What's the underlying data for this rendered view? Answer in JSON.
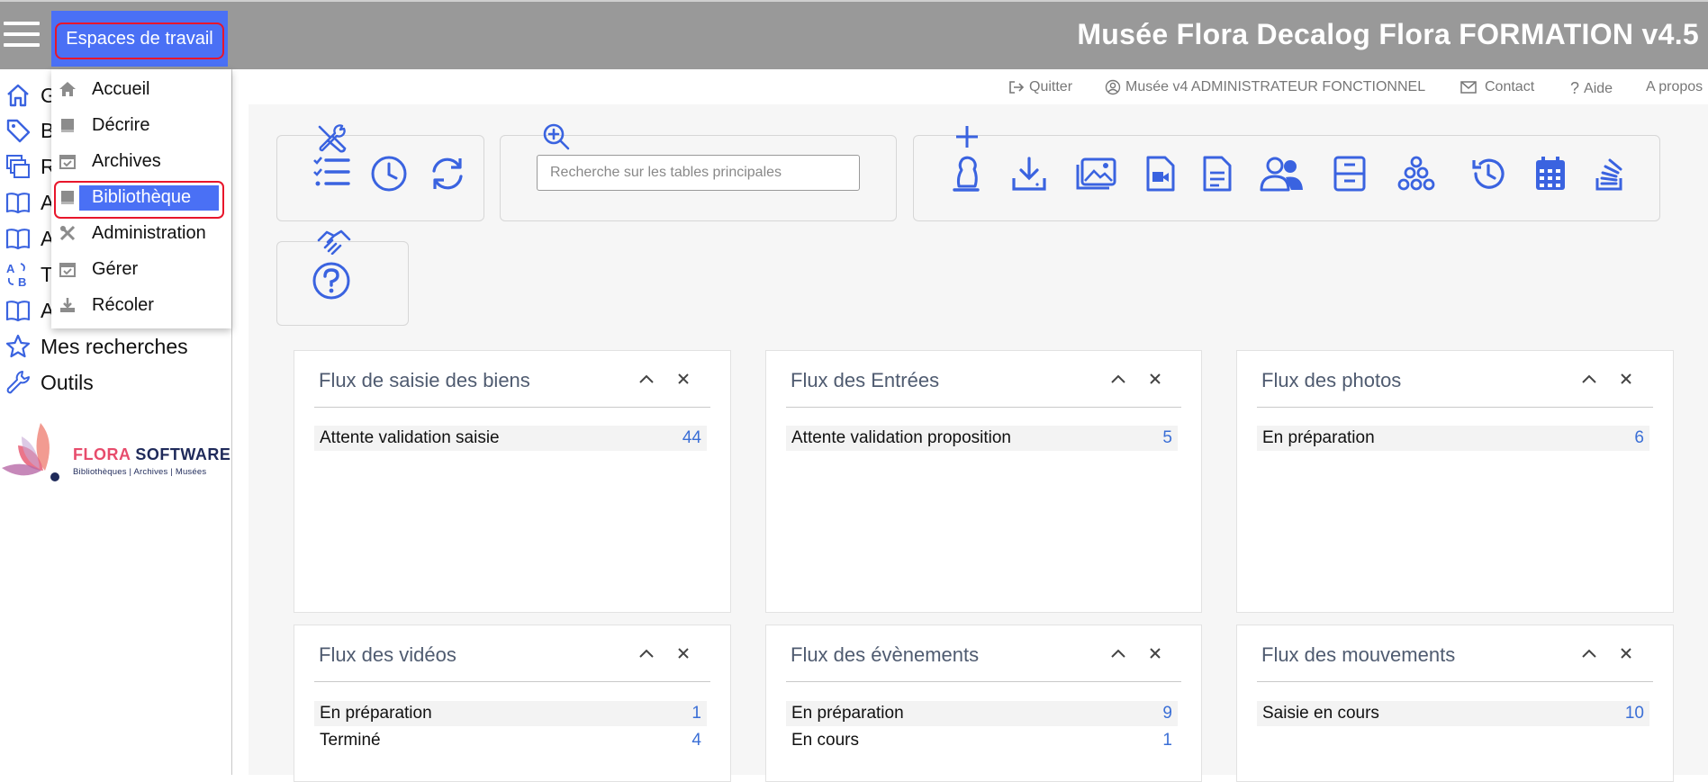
{
  "header": {
    "workspace_button": "Espaces de travail",
    "app_title": "Musée Flora Decalog Flora FORMATION v4.5"
  },
  "sidebar": {
    "items": [
      {
        "label": "G",
        "icon": "home-icon"
      },
      {
        "label": "B",
        "icon": "tag-icon"
      },
      {
        "label": "R",
        "icon": "stack-icon"
      },
      {
        "label": "A",
        "icon": "book-icon"
      },
      {
        "label": "A",
        "icon": "book-icon"
      },
      {
        "label": "T",
        "icon": "sort-az-icon"
      },
      {
        "label": "A",
        "icon": "book-icon"
      },
      {
        "label": "Mes recherches",
        "icon": "star-icon"
      },
      {
        "label": "Outils",
        "icon": "wrench-icon"
      }
    ],
    "logo": {
      "brand_a": "FLORA",
      "brand_b": "SOFTWARE",
      "tagline": "Bibliothèques | Archives | Musées"
    }
  },
  "dropdown": {
    "items": [
      {
        "label": "Accueil",
        "icon": "home-icon"
      },
      {
        "label": "Décrire",
        "icon": "book-icon"
      },
      {
        "label": "Archives",
        "icon": "calendar-check-icon"
      },
      {
        "label": "Bibliothèque",
        "icon": "book-icon"
      },
      {
        "label": "Administration",
        "icon": "tools-icon"
      },
      {
        "label": "Gérer",
        "icon": "calendar-check-icon"
      },
      {
        "label": "Récoler",
        "icon": "download-icon"
      }
    ],
    "active_index": 3
  },
  "toplinks": {
    "quit": "Quitter",
    "user": "Musée v4 ADMINISTRATEUR FONCTIONNEL",
    "contact": "Contact",
    "help": "Aide",
    "about": "A propos"
  },
  "search": {
    "placeholder": "Recherche sur les tables principales"
  },
  "colors": {
    "accent": "#4a70f5",
    "icon": "#3a63e0",
    "header": "#999999",
    "highlight_ring": "#e8162b"
  },
  "cards": [
    {
      "title": "Flux de saisie des biens",
      "rows": [
        {
          "label": "Attente validation saisie",
          "value": "44"
        }
      ]
    },
    {
      "title": "Flux des Entrées",
      "rows": [
        {
          "label": "Attente validation proposition",
          "value": "5"
        }
      ]
    },
    {
      "title": "Flux des photos",
      "rows": [
        {
          "label": "En préparation",
          "value": "6"
        }
      ]
    },
    {
      "title": "Flux des vidéos",
      "rows": [
        {
          "label": "En préparation",
          "value": "1"
        },
        {
          "label": "Terminé",
          "value": "4"
        }
      ]
    },
    {
      "title": "Flux des évènements",
      "rows": [
        {
          "label": "En préparation",
          "value": "9"
        },
        {
          "label": "En cours",
          "value": "1"
        }
      ]
    },
    {
      "title": "Flux des mouvements",
      "rows": [
        {
          "label": "Saisie en cours",
          "value": "10"
        }
      ]
    }
  ]
}
